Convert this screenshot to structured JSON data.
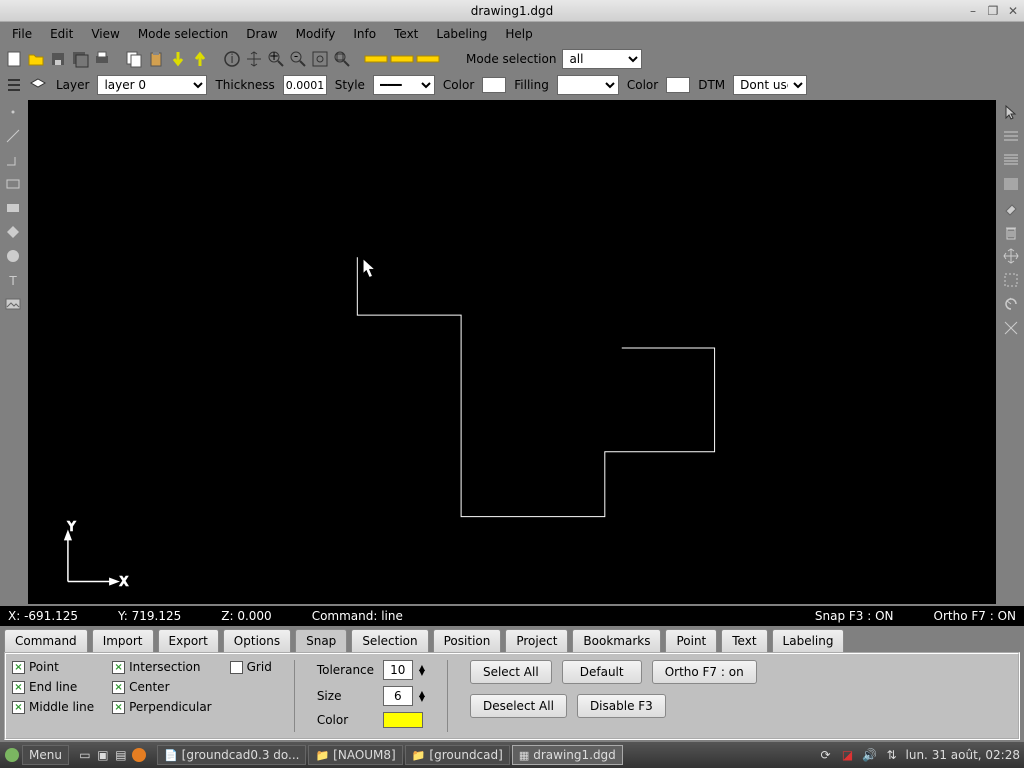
{
  "window": {
    "title": "drawing1.dgd"
  },
  "menubar": [
    "File",
    "Edit",
    "View",
    "Mode selection",
    "Draw",
    "Modify",
    "Info",
    "Text",
    "Labeling",
    "Help"
  ],
  "toolbar1": {
    "mode_label": "Mode selection",
    "mode_value": "all"
  },
  "properties": {
    "layer_label": "Layer",
    "layer_value": "layer 0",
    "thickness_label": "Thickness",
    "thickness_value": "0.0001",
    "style_label": "Style",
    "color_label": "Color",
    "filling_label": "Filling",
    "color2_label": "Color",
    "dtm_label": "DTM",
    "dtm_value": "Dont use"
  },
  "status": {
    "x": "X: -691.125",
    "y": "Y: 719.125",
    "z": "Z: 0.000",
    "command": "Command: line",
    "snap": "Snap F3 : ON",
    "ortho": "Ortho F7 : ON"
  },
  "tabs": [
    "Command",
    "Import",
    "Export",
    "Options",
    "Snap",
    "Selection",
    "Position",
    "Project",
    "Bookmarks",
    "Point",
    "Text",
    "Labeling"
  ],
  "active_tab": 4,
  "snap_panel": {
    "checks_col1": [
      "Point",
      "End line",
      "Middle line"
    ],
    "checks_col2": [
      "Intersection",
      "Center",
      "Perpendicular"
    ],
    "grid_label": "Grid",
    "tolerance_label": "Tolerance",
    "tolerance_value": "10",
    "size_label": "Size",
    "size_value": "6",
    "color_label": "Color",
    "buttons_row1": [
      "Select All",
      "Default",
      "Ortho F7 : on"
    ],
    "buttons_row2": [
      "Deselect All",
      "Disable  F3"
    ]
  },
  "taskbar": {
    "menu": "Menu",
    "items": [
      "[groundcad0.3 do...",
      "[NAOUM8]",
      "[groundcad]",
      "drawing1.dgd"
    ],
    "active_item": 3,
    "clock": "lun. 31 août, 02:28"
  },
  "left_icons": [
    "point",
    "line",
    "polyline",
    "rect",
    "rect-fill",
    "diamond",
    "circle",
    "text-tool",
    "image"
  ],
  "right_icons": [
    "cursor",
    "hlines",
    "hlines2",
    "hlines3",
    "eraser",
    "trash",
    "move",
    "marquee",
    "undo",
    "divider"
  ]
}
